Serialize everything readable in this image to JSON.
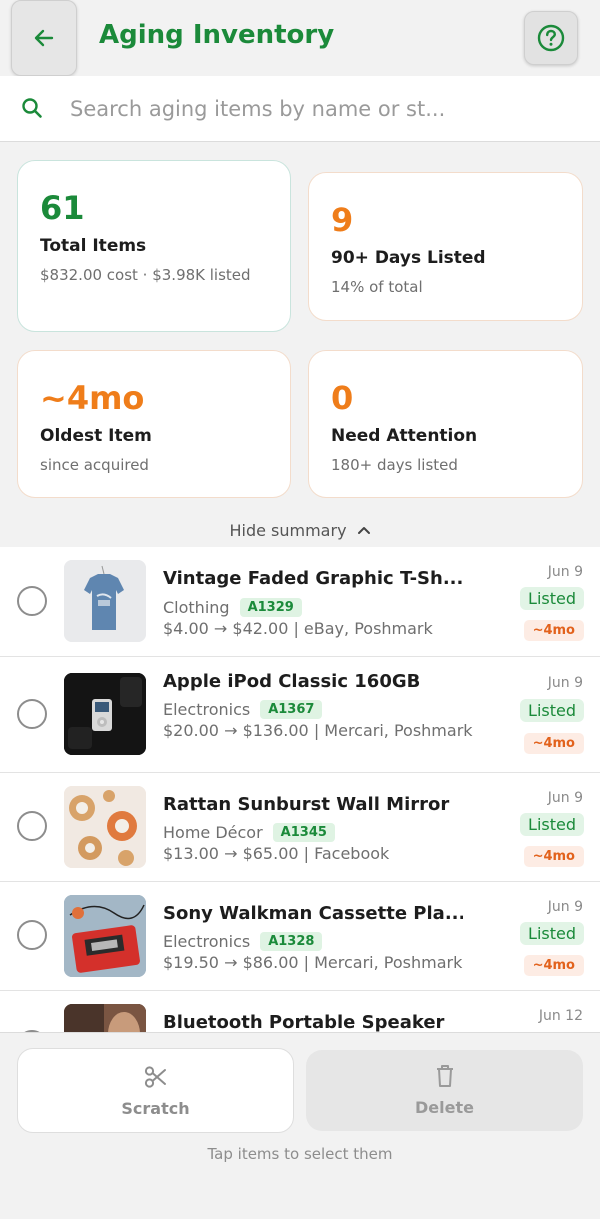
{
  "header": {
    "title": "Aging Inventory",
    "back_icon": "arrow-left-icon",
    "help_icon": "question-circle-icon"
  },
  "search": {
    "placeholder": "Search aging items by name or st...",
    "icon": "search-icon"
  },
  "summary": {
    "cards": [
      {
        "value": "61",
        "label": "Total Items",
        "sub": "$832.00 cost · $3.98K listed",
        "color": "#1b8a3a"
      },
      {
        "value": "9",
        "label": "90+ Days Listed",
        "sub": "14% of total",
        "color": "#ef7d1a"
      },
      {
        "value": "~4mo",
        "label": "Oldest Item",
        "sub": "since acquired",
        "color": "#ef7d1a"
      },
      {
        "value": "0",
        "label": "Need Attention",
        "sub": "180+ days listed",
        "color": "#ef7d1a"
      }
    ],
    "toggle_label": "Hide summary"
  },
  "items": [
    {
      "title": "Vintage Faded Graphic T-Sh...",
      "category": "Clothing",
      "sku": "A1329",
      "price": "$4.00 → $42.00 | eBay, Poshmark",
      "date": "Jun 9",
      "status": "Listed",
      "age": "~4mo",
      "thumb": "tshirt-photo"
    },
    {
      "title": "Apple iPod Classic 160GB",
      "category": "Electronics",
      "sku": "A1367",
      "price": "$20.00 → $136.00 | Mercari, Poshmark",
      "date": "Jun 9",
      "status": "Listed",
      "age": "~4mo",
      "thumb": "ipod-photo"
    },
    {
      "title": "Rattan Sunburst Wall Mirror",
      "category": "Home Décor",
      "sku": "A1345",
      "price": "$13.00 → $65.00 | Facebook",
      "date": "Jun 9",
      "status": "Listed",
      "age": "~4mo",
      "thumb": "mirror-photo"
    },
    {
      "title": "Sony Walkman Cassette Pla...",
      "category": "Electronics",
      "sku": "A1328",
      "price": "$19.50 → $86.00 | Mercari, Poshmark",
      "date": "Jun 9",
      "status": "Listed",
      "age": "~4mo",
      "thumb": "walkman-photo"
    },
    {
      "title": "Bluetooth Portable Speaker",
      "category": "",
      "sku": "",
      "price": "",
      "date": "Jun 12",
      "status": "",
      "age": "",
      "thumb": "speaker-photo"
    }
  ],
  "bottom": {
    "scratch_label": "Scratch",
    "delete_label": "Delete",
    "hint": "Tap items to select them",
    "scratch_icon": "scissors-icon",
    "delete_icon": "trash-icon"
  }
}
